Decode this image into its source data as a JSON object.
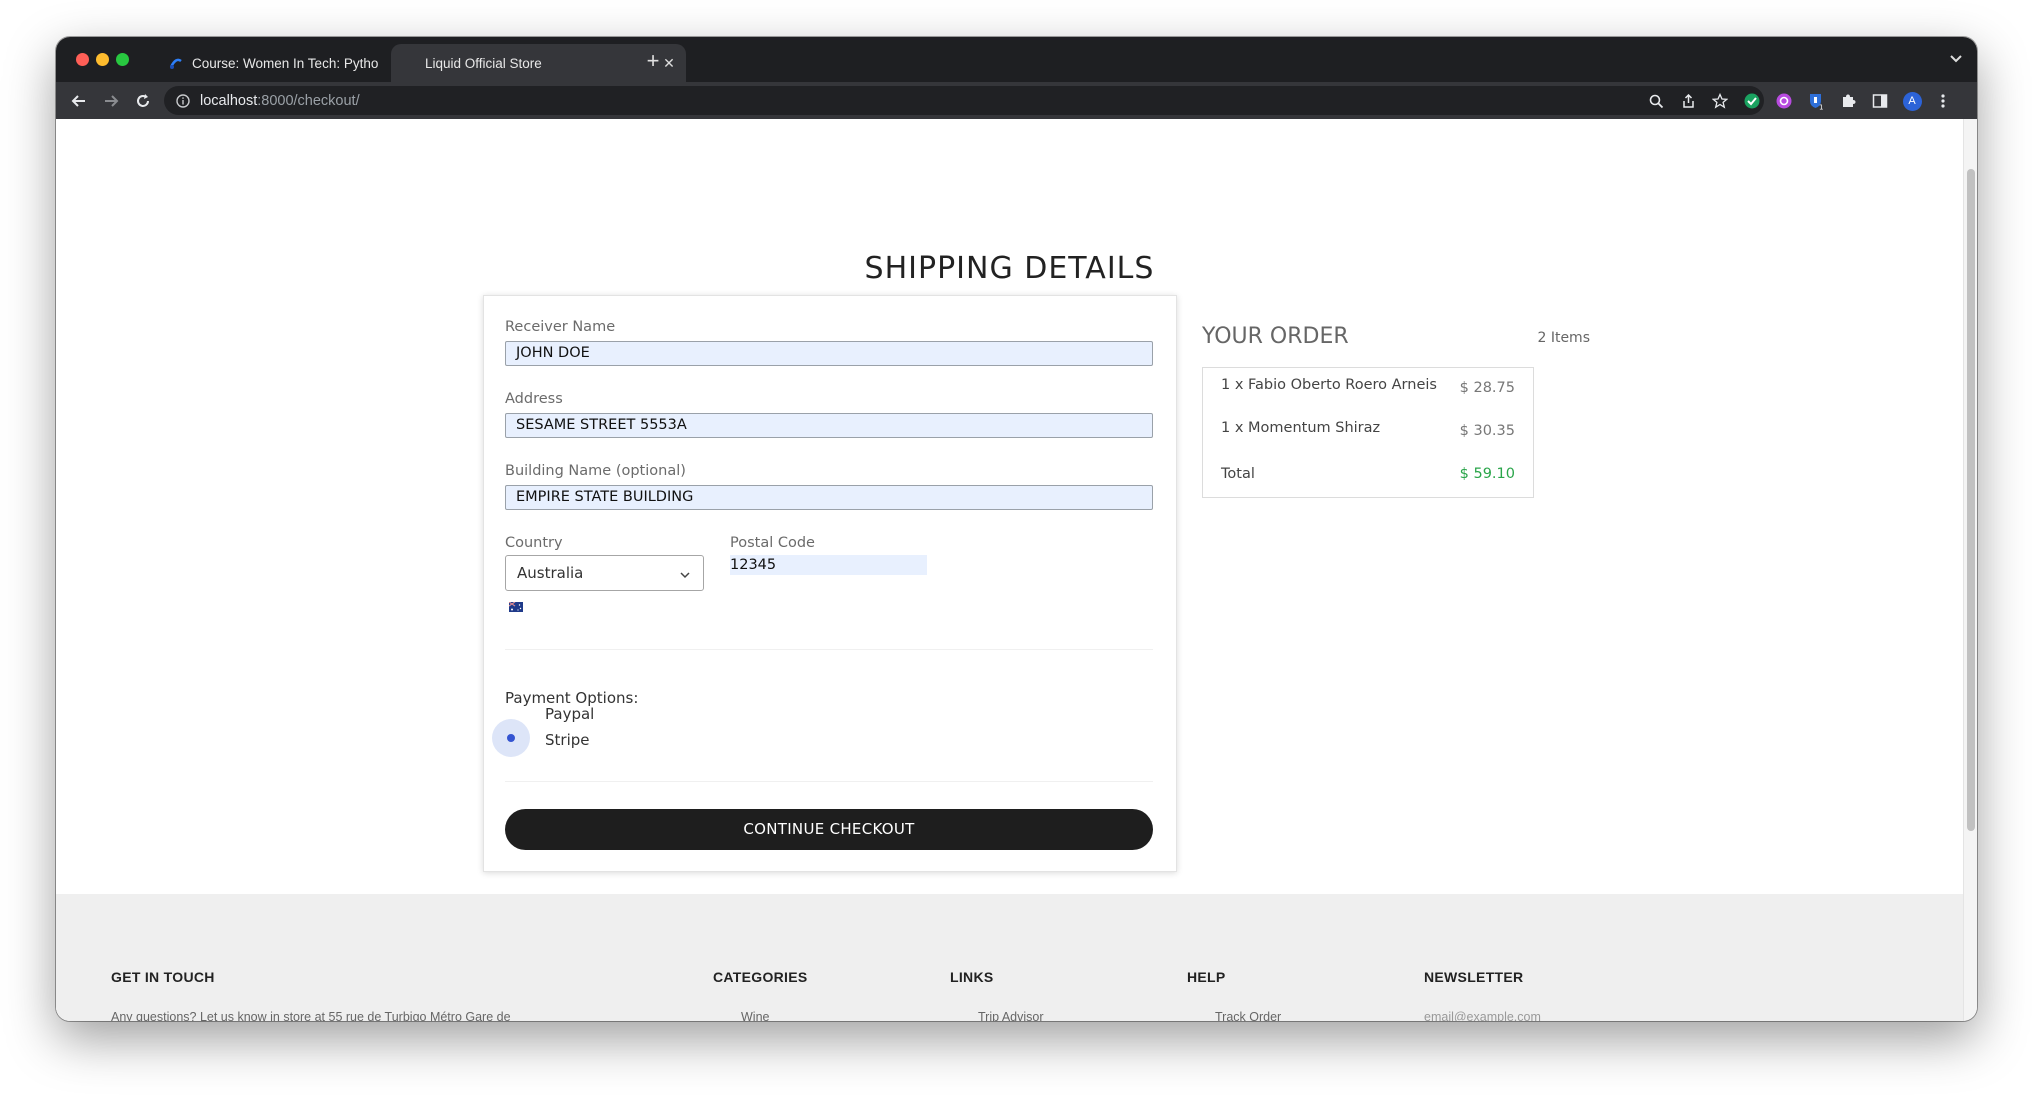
{
  "browser": {
    "tabs": [
      {
        "title": "Course: Women In Tech: Pytho",
        "active": false
      },
      {
        "title": "Liquid Official Store",
        "active": true
      }
    ],
    "new_tab_label": "+",
    "close_glyph": "✕",
    "url_host": "localhost",
    "url_rest": ":8000/checkout/",
    "profile_initial": "A",
    "extension_badge": "1"
  },
  "page": {
    "title": "SHIPPING DETAILS"
  },
  "form": {
    "receiver_label": "Receiver Name",
    "receiver_value": "JOHN DOE",
    "address_label": "Address",
    "address_value": "SESAME STREET 5553A",
    "building_label": "Building Name (optional)",
    "building_value": "EMPIRE STATE BUILDING",
    "country_label": "Country",
    "country_value": "Australia",
    "postal_label": "Postal Code",
    "postal_value": "12345",
    "payment_label": "Payment Options:",
    "payment_options": [
      "Paypal",
      "Stripe"
    ],
    "payment_selected": "Stripe",
    "submit_label": "CONTINUE CHECKOUT"
  },
  "order": {
    "title": "YOUR ORDER",
    "count": "2 Items",
    "items": [
      {
        "name": "1 x Fabio Oberto Roero Arneis",
        "price": "$ 28.75"
      },
      {
        "name": "1 x Momentum Shiraz",
        "price": "$ 30.35"
      }
    ],
    "total_label": "Total",
    "total_value": "$ 59.10"
  },
  "footer": {
    "get_in_touch": "GET IN TOUCH",
    "get_in_touch_text": "Any questions? Let us know in store at 55 rue de Turbigo Métro Gare de",
    "categories": "CATEGORIES",
    "categories_item": "Wine",
    "links": "LINKS",
    "links_item": "Trip Advisor",
    "help": "HELP",
    "help_item": "Track Order",
    "newsletter": "NEWSLETTER",
    "newsletter_placeholder": "email@example.com"
  },
  "colors": {
    "accent_total": "#2aa54a",
    "button_bg": "#1e1e1e",
    "autofill_bg": "#e8f0fe",
    "radio_selected": "#3454d1"
  }
}
